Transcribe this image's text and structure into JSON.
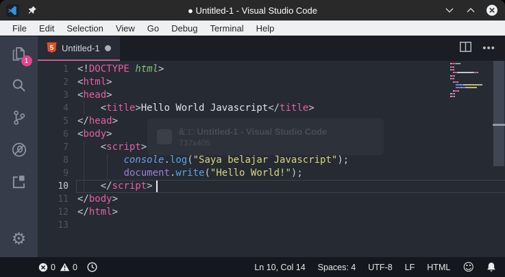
{
  "window": {
    "title": "● Untitled-1 - Visual Studio Code",
    "controls": [
      "minimize",
      "maximize",
      "close"
    ]
  },
  "menu": {
    "items": [
      "File",
      "Edit",
      "Selection",
      "View",
      "Go",
      "Debug",
      "Terminal",
      "Help"
    ]
  },
  "activity_bar": {
    "badge": "1",
    "items": [
      "explorer",
      "search",
      "source-control",
      "debug",
      "extensions"
    ],
    "bottom_items": [
      "settings"
    ]
  },
  "tab_bar": {
    "tabs": [
      {
        "label": "Untitled-1",
        "icon": "html5",
        "modified": true
      }
    ],
    "actions": [
      "split-editor",
      "more-actions"
    ]
  },
  "editor": {
    "cursor": {
      "line": 10,
      "col": 14
    },
    "lines": [
      {
        "n": 1,
        "indent": 0,
        "segs": [
          {
            "t": "<!",
            "c": "punct"
          },
          {
            "t": "DOCTYPE",
            "c": "tag"
          },
          {
            "t": " ",
            "c": "punct"
          },
          {
            "t": "html",
            "c": "doctypeVal",
            "i": true
          },
          {
            "t": ">",
            "c": "punct"
          }
        ]
      },
      {
        "n": 2,
        "indent": 0,
        "segs": [
          {
            "t": "<",
            "c": "punct"
          },
          {
            "t": "html",
            "c": "tag"
          },
          {
            "t": ">",
            "c": "punct"
          }
        ]
      },
      {
        "n": 3,
        "indent": 0,
        "segs": [
          {
            "t": "<",
            "c": "punct"
          },
          {
            "t": "head",
            "c": "tag"
          },
          {
            "t": ">",
            "c": "punct"
          }
        ]
      },
      {
        "n": 4,
        "indent": 4,
        "segs": [
          {
            "t": "<",
            "c": "punct"
          },
          {
            "t": "title",
            "c": "tag"
          },
          {
            "t": ">",
            "c": "punct"
          },
          {
            "t": "Hello World Javascript",
            "c": "text"
          },
          {
            "t": "</",
            "c": "punct"
          },
          {
            "t": "title",
            "c": "tag"
          },
          {
            "t": ">",
            "c": "punct"
          }
        ]
      },
      {
        "n": 5,
        "indent": 0,
        "segs": [
          {
            "t": "</",
            "c": "punct"
          },
          {
            "t": "head",
            "c": "tag"
          },
          {
            "t": ">",
            "c": "punct"
          }
        ]
      },
      {
        "n": 6,
        "indent": 0,
        "segs": [
          {
            "t": "<",
            "c": "punct"
          },
          {
            "t": "body",
            "c": "tag"
          },
          {
            "t": ">",
            "c": "punct"
          }
        ]
      },
      {
        "n": 7,
        "indent": 4,
        "segs": [
          {
            "t": "<",
            "c": "punct"
          },
          {
            "t": "script",
            "c": "tag"
          },
          {
            "t": ">",
            "c": "punct"
          }
        ]
      },
      {
        "n": 8,
        "indent": 8,
        "segs": [
          {
            "t": "console",
            "c": "consoleObj",
            "i": true
          },
          {
            "t": ".",
            "c": "punct"
          },
          {
            "t": "log",
            "c": "method"
          },
          {
            "t": "(",
            "c": "punct"
          },
          {
            "t": "\"Saya belajar Javascript\"",
            "c": "string"
          },
          {
            "t": ");",
            "c": "punct"
          }
        ]
      },
      {
        "n": 9,
        "indent": 8,
        "segs": [
          {
            "t": "document",
            "c": "documentObj"
          },
          {
            "t": ".",
            "c": "punct"
          },
          {
            "t": "write",
            "c": "method"
          },
          {
            "t": "(",
            "c": "punct"
          },
          {
            "t": "\"Hello World!\"",
            "c": "string"
          },
          {
            "t": ");",
            "c": "punct"
          }
        ]
      },
      {
        "n": 10,
        "indent": 4,
        "segs": [
          {
            "t": "</",
            "c": "punct"
          },
          {
            "t": "script",
            "c": "tag"
          },
          {
            "t": ">",
            "c": "punct"
          }
        ]
      },
      {
        "n": 11,
        "indent": 0,
        "segs": [
          {
            "t": "</",
            "c": "punct"
          },
          {
            "t": "body",
            "c": "tag"
          },
          {
            "t": ">",
            "c": "punct"
          }
        ]
      },
      {
        "n": 12,
        "indent": 0,
        "segs": [
          {
            "t": "</",
            "c": "punct"
          },
          {
            "t": "html",
            "c": "tag"
          },
          {
            "t": ">",
            "c": "punct"
          }
        ]
      },
      {
        "n": 13,
        "indent": 0,
        "segs": []
      }
    ]
  },
  "watermark": {
    "line1": "â□□ Untitled-1 - Visual Studio Code",
    "line2": "737x405"
  },
  "status_bar": {
    "errors": "0",
    "warnings": "0",
    "right_items": [
      {
        "name": "cursor-position",
        "label": "Ln 10, Col 14"
      },
      {
        "name": "indentation",
        "label": "Spaces: 4"
      },
      {
        "name": "encoding",
        "label": "UTF-8"
      },
      {
        "name": "eol",
        "label": "LF"
      },
      {
        "name": "language-mode",
        "label": "HTML"
      }
    ]
  },
  "colors": {
    "tag": "#e75fa5",
    "punct": "#c9ccd4",
    "doctypeVal": "#83c576",
    "text": "#dfe3ea",
    "string": "#d6d97b",
    "method": "#58a6e6",
    "consoleObj": "#6f9ee8",
    "documentObj": "#9a80dd",
    "tabUnderline": "#c05f93",
    "badge": "#e0448e",
    "editorBg": "#262a33",
    "activityBg": "#363c49",
    "statusBg": "#14171e",
    "titleBg": "#292929",
    "menuBg": "#eff0f1",
    "html5": "#e44d26"
  }
}
